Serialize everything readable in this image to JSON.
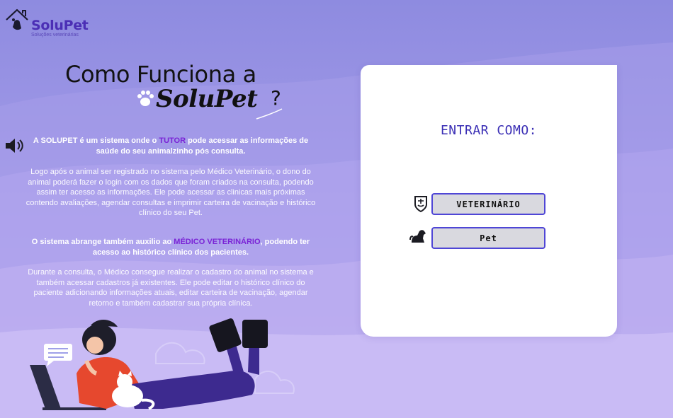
{
  "logo": {
    "name": "SoluPet",
    "tagline": "Soluções veterinárias"
  },
  "headline": {
    "line1": "Como Funciona a",
    "brand": "SoluPet",
    "question_mark": "?"
  },
  "intro": {
    "part1": "A SOLUPET é um sistema onde o ",
    "highlight": "TUTOR",
    "part2": " pode acessar as informações de saúde do seu animalzinho pós consulta."
  },
  "paragraph_tutor": "Logo após o animal ser registrado no sistema pelo Médico Veterinário, o dono do animal poderá fazer o login com os dados que foram criados na consulta, podendo assim ter acesso as informações. Ele pode acessar as clinicas mais próximas contendo avaliações, agendar consultas e imprimir carteira de vacinação e histórico clínico do seu Pet.",
  "vet_intro": {
    "part1": "O sistema abrange também auxilio ao ",
    "highlight": "MÉDICO VETERINÁRIO",
    "part2": ", podendo ter acesso ao histórico clínico dos pacientes."
  },
  "paragraph_vet": "Durante a consulta, o Médico consegue realizar o cadastro do animal no sistema e também acessar cadastros já existentes. Ele pode editar o histórico clínico do paciente adicionando informações atuais, editar carteira de vacinação, agendar retorno e também cadastrar sua própria clínica.",
  "login": {
    "title": "ENTRAR COMO:",
    "options": [
      {
        "label": "VETERINÁRIO",
        "icon": "vet-badge-icon"
      },
      {
        "label": "Pet",
        "icon": "dog-icon"
      }
    ]
  },
  "colors": {
    "accent": "#4f46d6",
    "highlight": "#7a24d6",
    "brand": "#4b2fb5"
  }
}
